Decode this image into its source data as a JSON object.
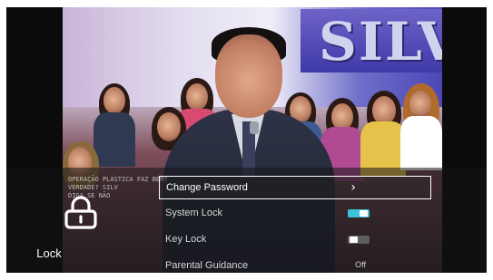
{
  "sidebar": {
    "label": "Lock",
    "icon": "padlock-icon"
  },
  "menu": {
    "items": [
      {
        "label": "Change Password",
        "control": "chevron",
        "selected": true
      },
      {
        "label": "System Lock",
        "control": "toggle",
        "state": "on"
      },
      {
        "label": "Key Lock",
        "control": "toggle",
        "state": "off"
      },
      {
        "label": "Parental Guidance",
        "control": "value",
        "value": "Off"
      }
    ]
  },
  "background_video": {
    "ticker_lines": [
      "OPERAÇÃO PLÁSTICA FAZ BEM?",
      "VERDADE? SILV",
      "DIGA SE NÃO"
    ],
    "sign_text": "SILV"
  },
  "colors": {
    "toggle_on": "#3cc3d7",
    "toggle_off": "#5e5e5e",
    "selection_border": "#ffffff"
  }
}
